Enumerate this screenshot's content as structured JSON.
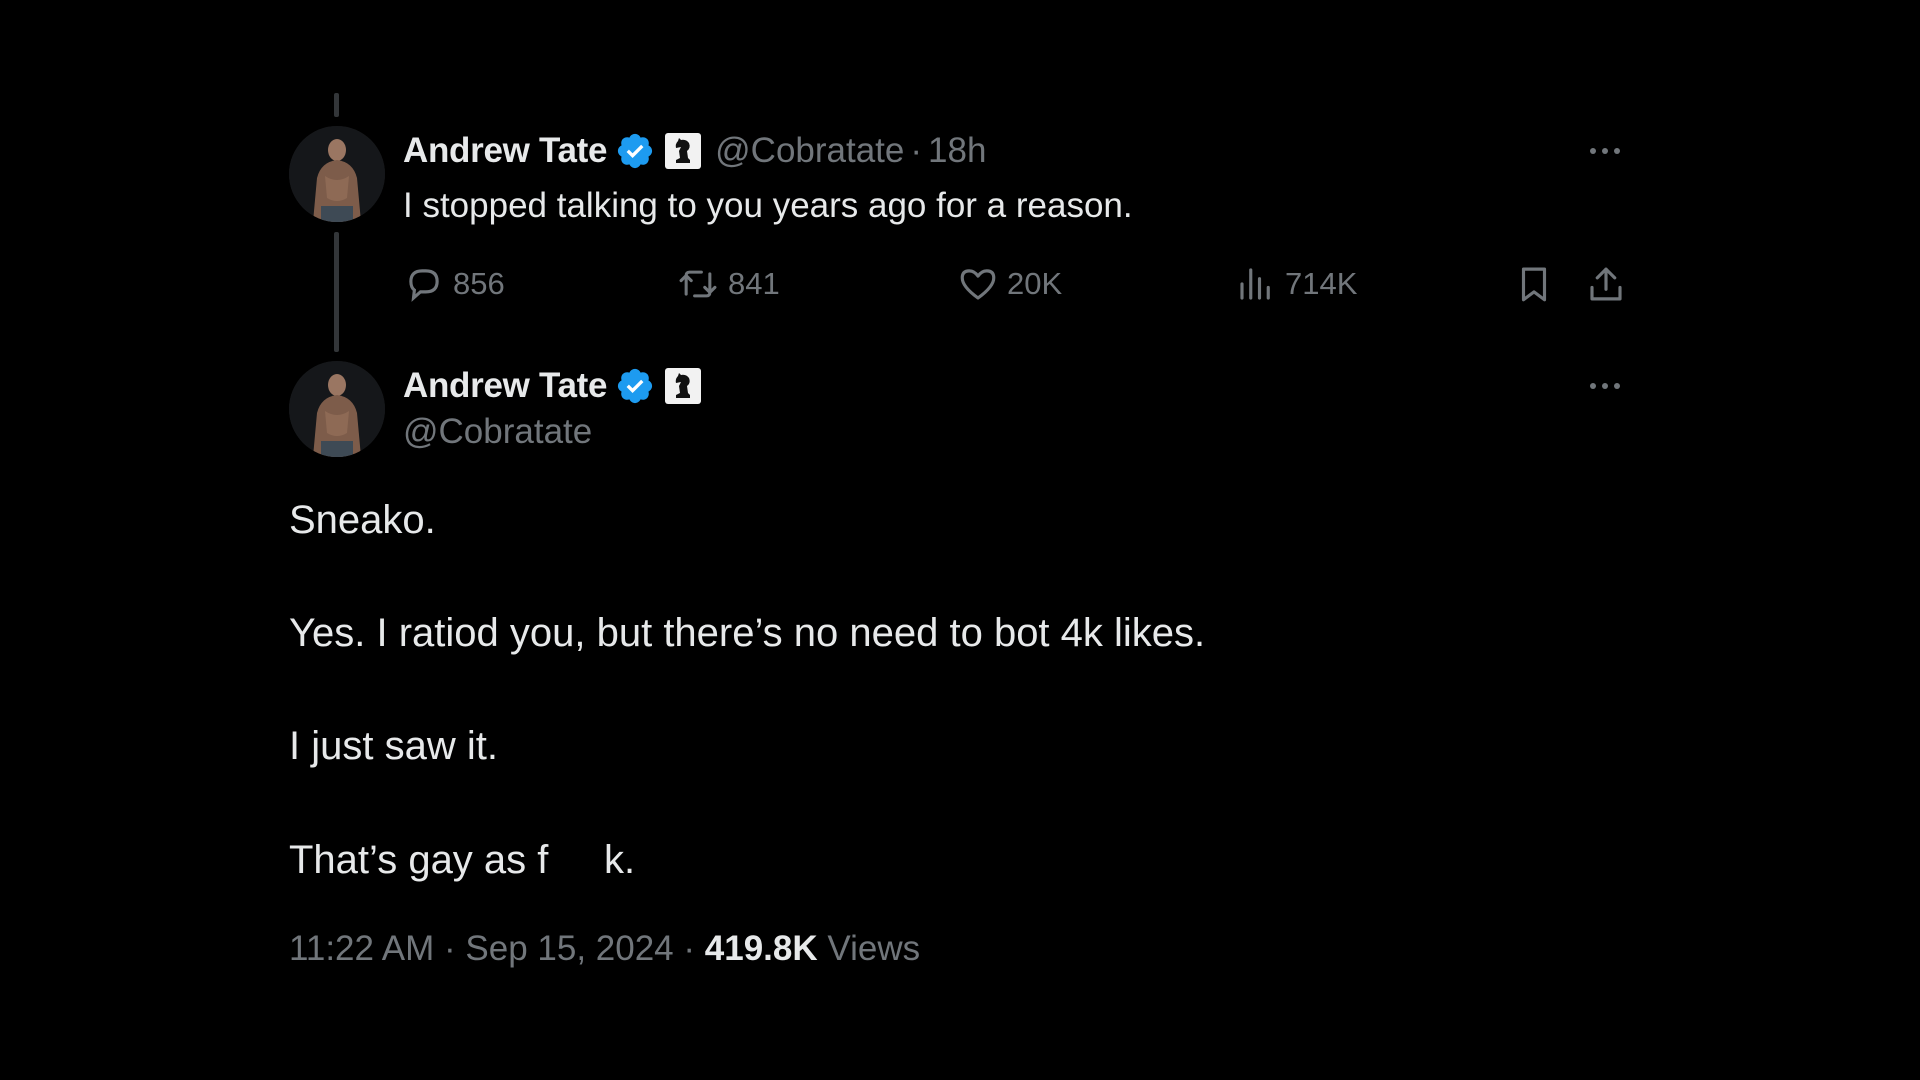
{
  "reply_tweet": {
    "author_name": "Andrew Tate",
    "handle": "@Cobratate",
    "separator": "·",
    "time_ago": "18h",
    "text": "I stopped talking to you years ago for a reason.",
    "actions": {
      "replies": "856",
      "reposts": "841",
      "likes": "20K",
      "views": "714K"
    }
  },
  "main_tweet": {
    "author_name": "Andrew Tate",
    "handle": "@Cobratate",
    "paragraphs": [
      "Sneako.",
      "Yes. I ratiod you, but there’s no need to bot 4k likes.",
      "I just saw it.",
      "That’s gay as f     k."
    ],
    "time": "11:22 AM",
    "separator": "·",
    "date": "Sep 15, 2024",
    "views_count": "419.8K",
    "views_label": "Views"
  },
  "icons": {
    "verified": "verified-badge-icon",
    "affiliate": "chess-knight-affiliate-icon",
    "more": "more-options-icon",
    "reply": "reply-bubble-icon",
    "repost": "repost-icon",
    "like": "heart-icon",
    "analytics": "analytics-bars-icon",
    "bookmark": "bookmark-icon",
    "share": "share-upload-icon"
  },
  "colors": {
    "background": "#000000",
    "text_primary": "#e7e9ea",
    "text_secondary": "#71767b",
    "verified_blue": "#1d9bf0",
    "thread_line": "#333639"
  }
}
